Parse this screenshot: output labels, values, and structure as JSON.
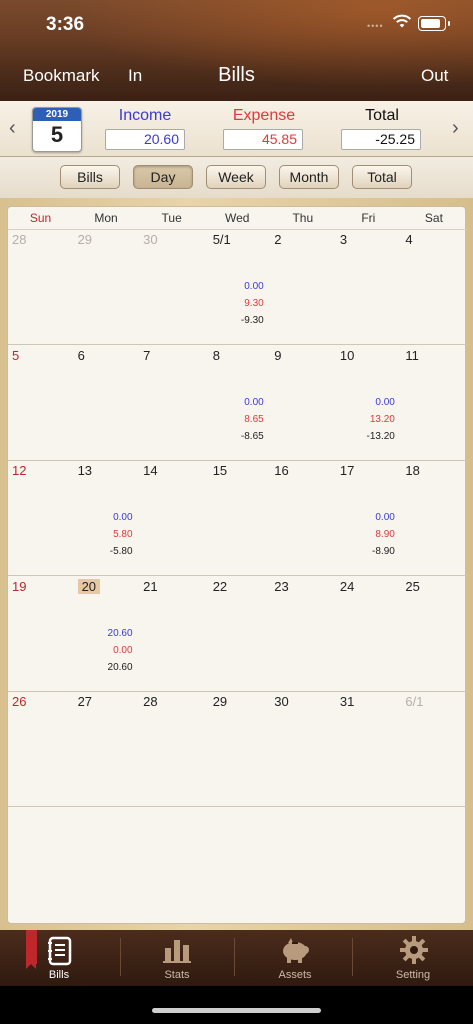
{
  "status": {
    "time": "3:36"
  },
  "nav": {
    "bookmark": "Bookmark",
    "in": "In",
    "title": "Bills",
    "out": "Out"
  },
  "summary": {
    "year": "2019",
    "month": "5",
    "income_label": "Income",
    "income_value": "20.60",
    "expense_label": "Expense",
    "expense_value": "45.85",
    "total_label": "Total",
    "total_value": "-25.25",
    "colors": {
      "income": "#3a3ad8",
      "expense": "#e0393b"
    }
  },
  "tabs": [
    "Bills",
    "Day",
    "Week",
    "Month",
    "Total"
  ],
  "active_tab": "Day",
  "weekdays": [
    "Sun",
    "Mon",
    "Tue",
    "Wed",
    "Thu",
    "Fri",
    "Sat"
  ],
  "calendar": {
    "weeks": [
      [
        {
          "d": "28",
          "other": true
        },
        {
          "d": "29",
          "other": true
        },
        {
          "d": "30",
          "other": true
        },
        {
          "d": "5/1",
          "inc": "0.00",
          "exp": "9.30",
          "tot": "-9.30"
        },
        {
          "d": "2"
        },
        {
          "d": "3"
        },
        {
          "d": "4"
        }
      ],
      [
        {
          "d": "5"
        },
        {
          "d": "6"
        },
        {
          "d": "7"
        },
        {
          "d": "8",
          "inc": "0.00",
          "exp": "8.65",
          "tot": "-8.65"
        },
        {
          "d": "9"
        },
        {
          "d": "10",
          "inc": "0.00",
          "exp": "13.20",
          "tot": "-13.20"
        },
        {
          "d": "11"
        }
      ],
      [
        {
          "d": "12"
        },
        {
          "d": "13",
          "inc": "0.00",
          "exp": "5.80",
          "tot": "-5.80"
        },
        {
          "d": "14"
        },
        {
          "d": "15"
        },
        {
          "d": "16"
        },
        {
          "d": "17",
          "inc": "0.00",
          "exp": "8.90",
          "tot": "-8.90"
        },
        {
          "d": "18"
        }
      ],
      [
        {
          "d": "19"
        },
        {
          "d": "20",
          "today": true,
          "inc": "20.60",
          "exp": "0.00",
          "tot": "20.60"
        },
        {
          "d": "21"
        },
        {
          "d": "22"
        },
        {
          "d": "23"
        },
        {
          "d": "24"
        },
        {
          "d": "25"
        }
      ],
      [
        {
          "d": "26"
        },
        {
          "d": "27"
        },
        {
          "d": "28"
        },
        {
          "d": "29"
        },
        {
          "d": "30"
        },
        {
          "d": "31"
        },
        {
          "d": "6/1",
          "other": true
        }
      ]
    ]
  },
  "tabbar": [
    {
      "label": "Bills",
      "icon": "notebook-icon",
      "active": true
    },
    {
      "label": "Stats",
      "icon": "bar-chart-icon",
      "active": false
    },
    {
      "label": "Assets",
      "icon": "piggy-bank-icon",
      "active": false
    },
    {
      "label": "Setting",
      "icon": "gear-icon",
      "active": false
    }
  ]
}
